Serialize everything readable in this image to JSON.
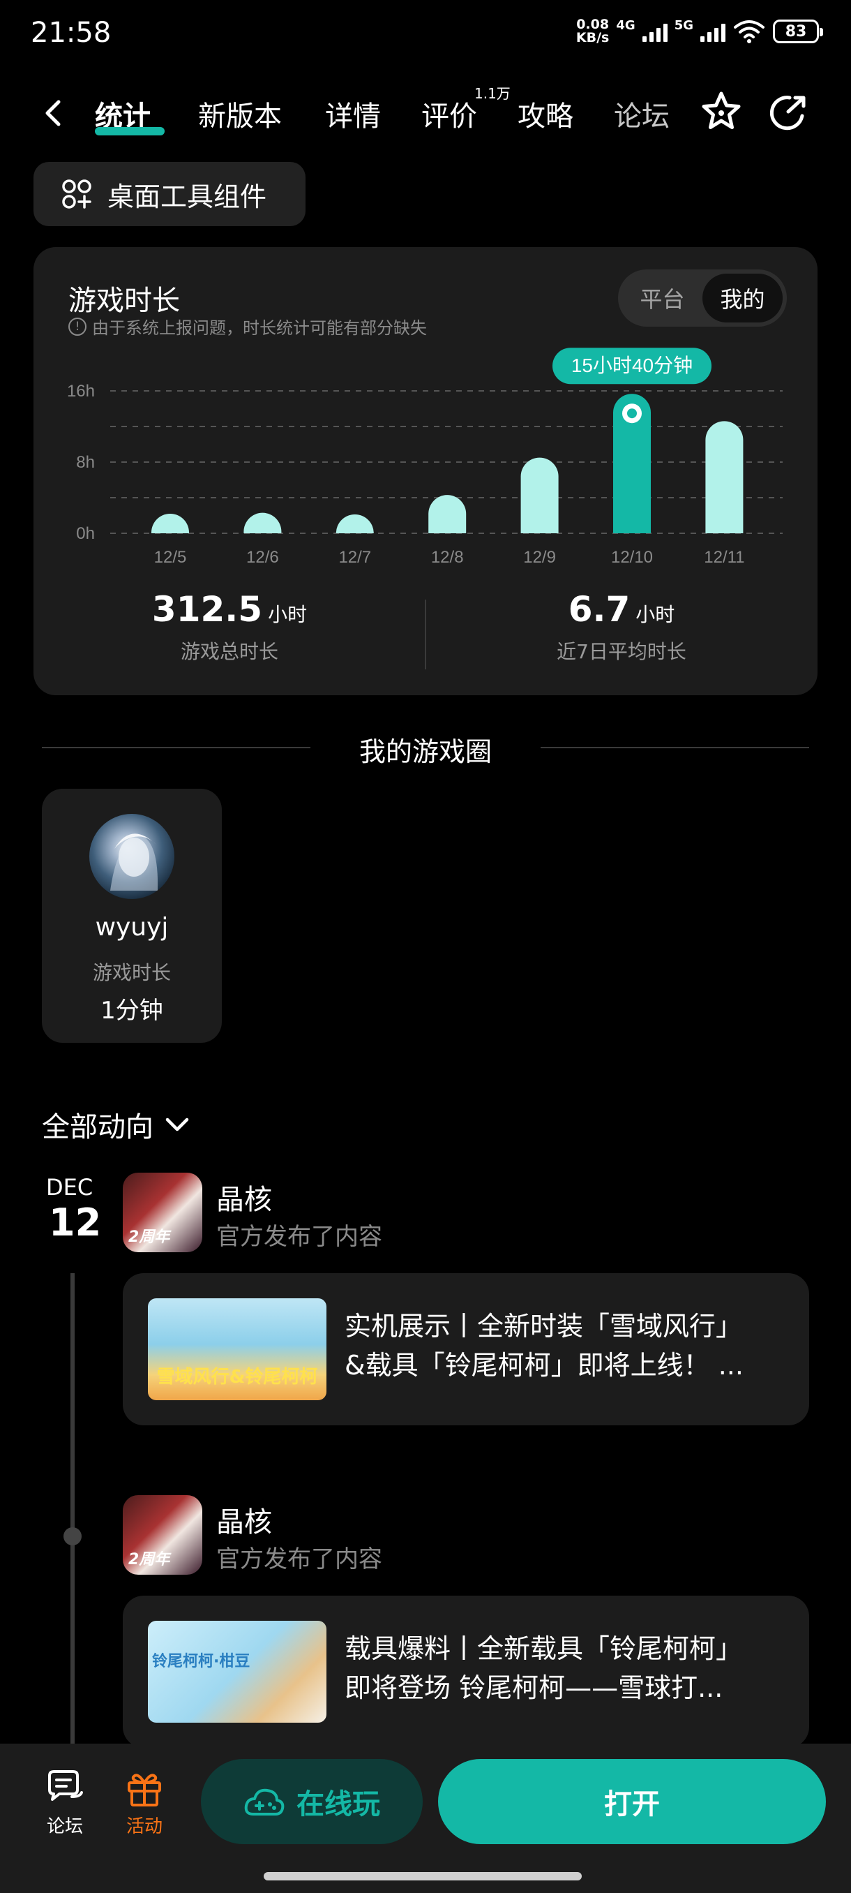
{
  "status_bar": {
    "time": "21:58",
    "net_speed_value": "0.08",
    "net_speed_unit": "KB/s",
    "sim1": "4G",
    "sim2": "5G",
    "battery": "83"
  },
  "nav": {
    "tabs": [
      {
        "label": "统计"
      },
      {
        "label": "新版本"
      },
      {
        "label": "详情"
      },
      {
        "label": "评价"
      },
      {
        "label": "攻略"
      },
      {
        "label": "论坛"
      }
    ],
    "review_badge": "1.1万"
  },
  "widget_button": {
    "label": "桌面工具组件"
  },
  "stats": {
    "title": "游戏时长",
    "note": "由于系统上报问题，时长统计可能有部分缺失",
    "toggle": [
      "平台",
      "我的"
    ],
    "selected_toggle": "我的",
    "tooltip": "15小时40分钟",
    "total_value": "312.5",
    "total_unit": "小时",
    "total_label": "游戏总时长",
    "avg_value": "6.7",
    "avg_unit": "小时",
    "avg_label": "近7日平均时长"
  },
  "chart_data": {
    "type": "bar",
    "categories": [
      "12/5",
      "12/6",
      "12/7",
      "12/8",
      "12/9",
      "12/10",
      "12/11"
    ],
    "values": [
      2.2,
      2.3,
      1.4,
      4.3,
      8.5,
      15.67,
      12.6
    ],
    "y_ticks": [
      "0h",
      "8h",
      "16h"
    ],
    "ylim": [
      0,
      16
    ],
    "highlight_index": 5,
    "grid": true,
    "colors": {
      "bar": "#b2f2ea",
      "highlight": "#14b8a6"
    }
  },
  "circle": {
    "title": "我的游戏圈",
    "member": {
      "name": "wyuyj",
      "label": "游戏时长",
      "time": "1分钟"
    }
  },
  "feed": {
    "filter_label": "全部动向",
    "date_month": "DEC",
    "date_day": "12",
    "posts": [
      {
        "author": "晶核",
        "sub": "官方发布了内容",
        "icon_badge": "2周年",
        "line1": "实机展示丨全新时装「雪域风行」",
        "line2": "&载具「铃尾柯柯」即将上线！ ...",
        "thumb_text": "雪域风行&铃尾柯柯"
      },
      {
        "author": "晶核",
        "sub": "官方发布了内容",
        "icon_badge": "2周年",
        "line1": "载具爆料丨全新载具「铃尾柯柯」",
        "line2": "即将登场 铃尾柯柯——雪球打...",
        "thumb_text": "铃尾柯柯·柑豆"
      }
    ]
  },
  "bottom_bar": {
    "forum_label": "论坛",
    "activity_label": "活动",
    "play_label": "在线玩",
    "open_label": "打开"
  },
  "colors": {
    "accent": "#14b8a6",
    "activity": "#f97316"
  }
}
